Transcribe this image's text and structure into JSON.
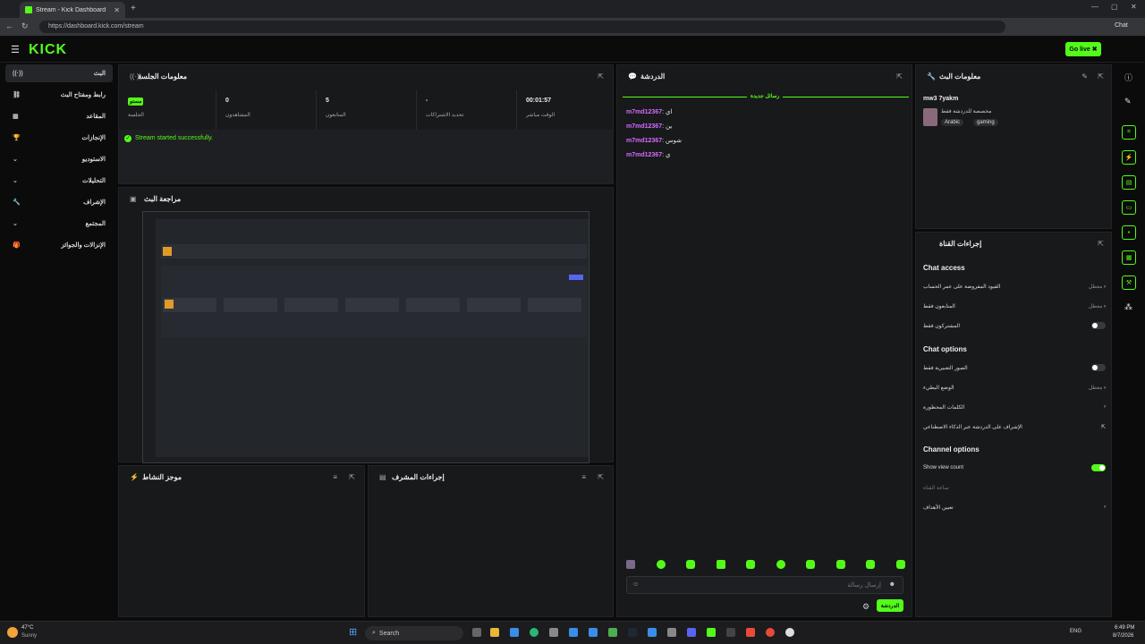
{
  "browser": {
    "tab_title": "Stream - Kick Dashboard",
    "url": "https://dashboard.kick.com/stream",
    "chat_label": "Chat"
  },
  "header": {
    "logo": "KICK",
    "go_live": "Go live"
  },
  "sidebar": {
    "items": [
      {
        "label": "البث"
      },
      {
        "label": "رابط ومفتاح البث"
      },
      {
        "label": "المقاعد"
      },
      {
        "label": "الإنجازات"
      },
      {
        "label": "الاستوديو"
      },
      {
        "label": "التحليلات"
      },
      {
        "label": "الإشراف"
      },
      {
        "label": "المجتمع"
      },
      {
        "label": "الإنزالات والجوائز"
      }
    ]
  },
  "session_info": {
    "title": "معلومات الجلسة",
    "stats": [
      {
        "value": "مستو",
        "label": "الجلسة"
      },
      {
        "value": "0",
        "label": "المشاهدون"
      },
      {
        "value": "5",
        "label": "المتابعون"
      },
      {
        "value": "-",
        "label": "تحديد الاشتراكات"
      },
      {
        "value": "00:01:57",
        "label": "الوقت مباشر"
      }
    ],
    "status": "Stream started successfully."
  },
  "preview": {
    "title": "مراجعة البث"
  },
  "activity": {
    "title": "موجز النشاط"
  },
  "mod_actions": {
    "title": "إجراءات المشرف"
  },
  "chat": {
    "title": "الدردشة",
    "divider": "رسائل جديدة",
    "messages": [
      {
        "user": "m7md12367",
        "text": "اي"
      },
      {
        "user": "m7md12367",
        "text": "ين"
      },
      {
        "user": "m7md12367",
        "text": "شوس"
      },
      {
        "user": "m7md12367",
        "text": "ي"
      }
    ],
    "placeholder": "إرسال رسالة",
    "send_label": "الدردشة"
  },
  "stream_info": {
    "title": "معلومات البث",
    "channel_name": "mw3 7yakm",
    "subtitle": "مخصصة للدردشة فقط",
    "tags": [
      "Arabic",
      "gaming"
    ]
  },
  "channel_actions": {
    "title": "إجراءات القناة",
    "chat_access_title": "Chat access",
    "chat_access": [
      {
        "label": "القيود المفروضة على عمر الحساب",
        "value": "معطل"
      },
      {
        "label": "المتابعون فقط",
        "value": "معطل"
      },
      {
        "label": "المشتركون فقط",
        "value": ""
      }
    ],
    "chat_options_title": "Chat options",
    "chat_options": [
      {
        "label": "الصور التعبيرية فقط",
        "value": ""
      },
      {
        "label": "الوضع البطيء",
        "value": "معطل"
      },
      {
        "label": "الكلمات المحظورة",
        "value": ""
      },
      {
        "label": "الإشراف على الدردشة عبر الذكاء الاصطناعي",
        "value": ""
      }
    ],
    "channel_options_title": "Channel options",
    "show_view_count": "Show view count",
    "channel_options": [
      {
        "label": "ساعة القناة"
      },
      {
        "label": "تعيين الأهداف"
      }
    ]
  },
  "taskbar": {
    "weather_temp": "47°C",
    "weather_text": "Sunny",
    "search": "Search",
    "lang": "ENG",
    "time": "6:49 PM",
    "date": "8/7/2026"
  }
}
